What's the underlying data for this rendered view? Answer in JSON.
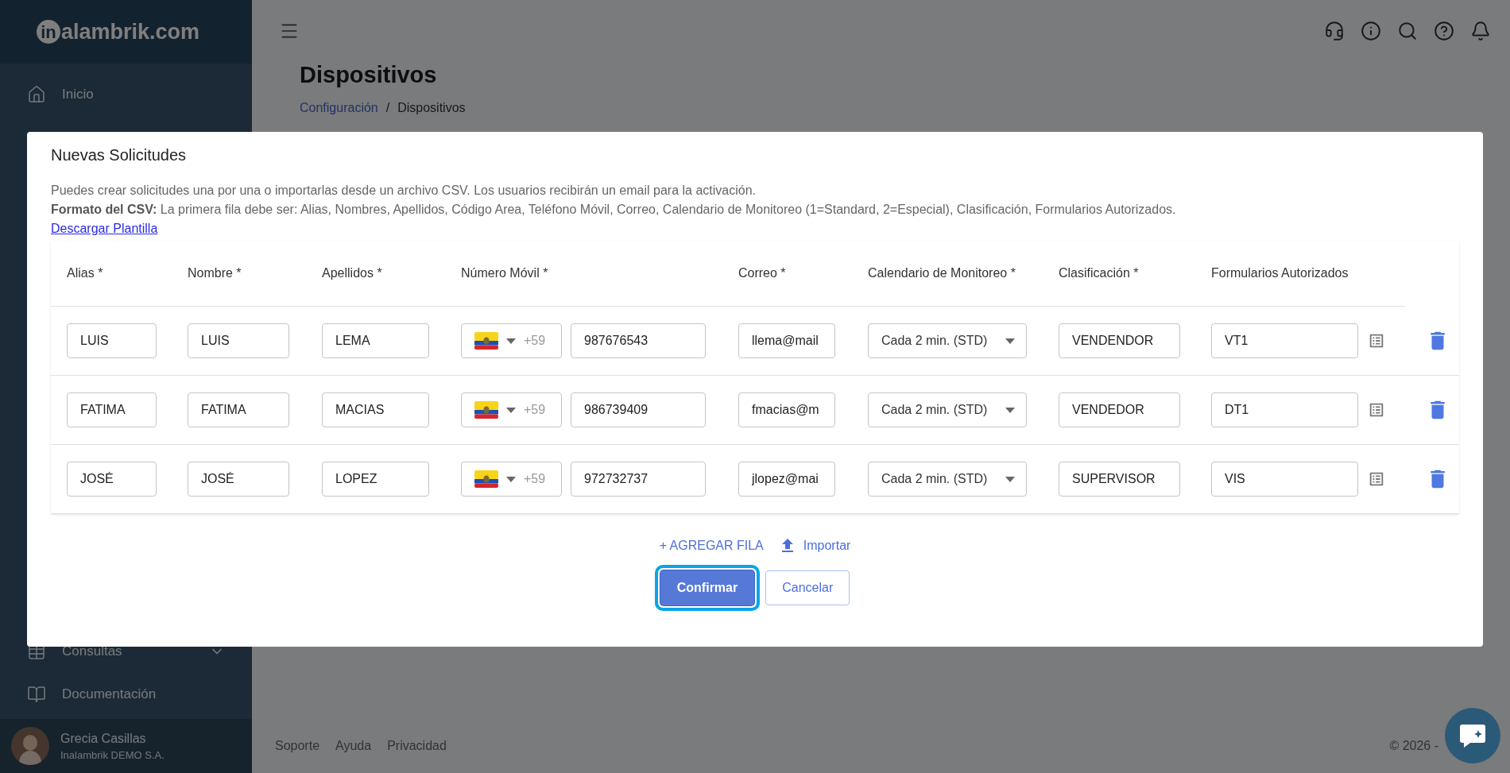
{
  "sidebar": {
    "logo": {
      "mark": "in",
      "text": "alambrik.com"
    },
    "items": [
      {
        "label": "Inicio",
        "kind": "home",
        "expandable": false
      }
    ],
    "bottom_items": [
      {
        "label": "Consultas",
        "kind": "table",
        "expandable": true
      },
      {
        "label": "Documentación",
        "kind": "book",
        "expandable": false
      }
    ],
    "user": {
      "name": "Grecia Casillas",
      "company": "Inalambrik DEMO S.A."
    }
  },
  "page": {
    "title": "Dispositivos",
    "breadcrumb": {
      "link": "Configuración",
      "separator": "/",
      "current": "Dispositivos"
    }
  },
  "modal": {
    "title": "Nuevas Solicitudes",
    "description": "Puedes crear solicitudes una por una o importarlas desde un archivo CSV. Los usuarios recibirán un email para la activación.",
    "format": "**Formato del CSV:** La primera fila debe ser: Alias, Nombres, Apellidos, Código Area, Teléfono Móvil, Correo, Calendario de Monitoreo (1=Standard, 2=Especial), Clasificación, Formularios Autorizados.",
    "template_link": "Descargar Plantilla",
    "columns": [
      "Alias *",
      "Nombre *",
      "Apellidos *",
      "Número Móvil *",
      "Correo *",
      "Calendario de Monitoreo *",
      "Clasificación *",
      "Formularios Autorizados"
    ],
    "rows": [
      {
        "alias": "LUIS",
        "nombre": "LUIS",
        "apellidos": "LEMA",
        "country_code": "+59",
        "phone": "987676543",
        "correo": "llema@mail",
        "calendario": "Cada 2 min. (STD)",
        "clasificacion": "VENDENDOR",
        "formularios": "VT1"
      },
      {
        "alias": "FATIMA",
        "nombre": "FATIMA",
        "apellidos": "MACIAS",
        "country_code": "+59",
        "phone": "986739409",
        "correo": "fmacias@m",
        "calendario": "Cada 2 min. (STD)",
        "clasificacion": "VENDEDOR",
        "formularios": "DT1"
      },
      {
        "alias": "JOSÉ",
        "nombre": "JOSÉ",
        "apellidos": "LOPEZ",
        "country_code": "+59",
        "phone": "972732737",
        "correo": "jlopez@mai",
        "calendario": "Cada 2 min. (STD)",
        "clasificacion": "SUPERVISOR",
        "formularios": "VIS"
      }
    ],
    "add_row": "+ AGREGAR FILA",
    "import": "Importar",
    "buttons": [
      {
        "label": "Confirmar",
        "kind": "primary",
        "focused": true
      },
      {
        "label": "Cancelar",
        "kind": "secondary",
        "focused": false
      }
    ]
  },
  "footer": {
    "links": [
      "Soporte",
      "Ayuda",
      "Privacidad"
    ],
    "copyright": "© 2026 -"
  }
}
